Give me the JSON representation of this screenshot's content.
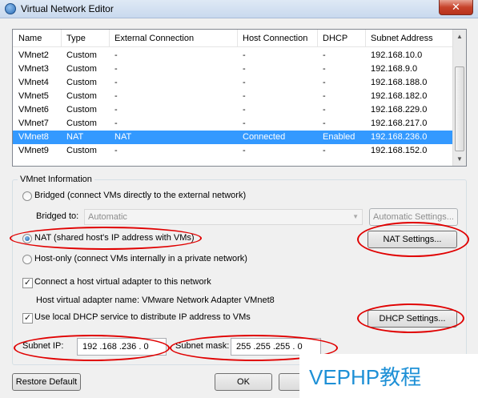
{
  "window": {
    "title": "Virtual Network Editor",
    "close_glyph": "✕"
  },
  "network_list": {
    "columns": [
      "Name",
      "Type",
      "External Connection",
      "Host Connection",
      "DHCP",
      "Subnet Address"
    ],
    "rows": [
      [
        "VMnet2",
        "Custom",
        "-",
        "-",
        "-",
        "192.168.10.0"
      ],
      [
        "VMnet3",
        "Custom",
        "-",
        "-",
        "-",
        "192.168.9.0"
      ],
      [
        "VMnet4",
        "Custom",
        "-",
        "-",
        "-",
        "192.168.188.0"
      ],
      [
        "VMnet5",
        "Custom",
        "-",
        "-",
        "-",
        "192.168.182.0"
      ],
      [
        "VMnet6",
        "Custom",
        "-",
        "-",
        "-",
        "192.168.229.0"
      ],
      [
        "VMnet7",
        "Custom",
        "-",
        "-",
        "-",
        "192.168.217.0"
      ],
      [
        "VMnet8",
        "NAT",
        "NAT",
        "Connected",
        "Enabled",
        "192.168.236.0"
      ],
      [
        "VMnet9",
        "Custom",
        "-",
        "-",
        "-",
        "192.168.152.0"
      ]
    ],
    "selected_row": 6,
    "scroll_up_glyph": "▲",
    "scroll_down_glyph": "▼"
  },
  "vmnet_info": {
    "group_label": "VMnet Information",
    "bridged_label": "Bridged (connect VMs directly to the external network)",
    "bridged_to_label": "Bridged to:",
    "bridged_to_value": "Automatic",
    "combo_arrow": "▼",
    "automatic_settings_label": "Automatic Settings...",
    "nat_label": "NAT (shared host's IP address with VMs)",
    "nat_settings_label": "NAT Settings...",
    "host_only_label": "Host-only (connect VMs internally in a private network)",
    "selected_mode": "nat",
    "connect_adapter_label": "Connect a host virtual adapter to this network",
    "connect_adapter_checked": true,
    "adapter_name_text": "Host virtual adapter name: VMware Network Adapter VMnet8",
    "use_dhcp_label": "Use local DHCP service to distribute IP address to VMs",
    "use_dhcp_checked": true,
    "dhcp_settings_label": "DHCP Settings...",
    "check_glyph": "✓",
    "subnet_ip_label": "Subnet IP:",
    "subnet_ip_value": "192 .168 .236 .  0",
    "subnet_mask_label": "Subnet mask:",
    "subnet_mask_value": "255 .255 .255 .  0"
  },
  "footer": {
    "restore_default_label": "Restore Default",
    "ok_label": "OK"
  },
  "watermark": {
    "text": "VEPHP教程",
    "color": "#1e90d6"
  },
  "colors": {
    "selection": "#3399ff",
    "annotation_red": "#e00000"
  }
}
